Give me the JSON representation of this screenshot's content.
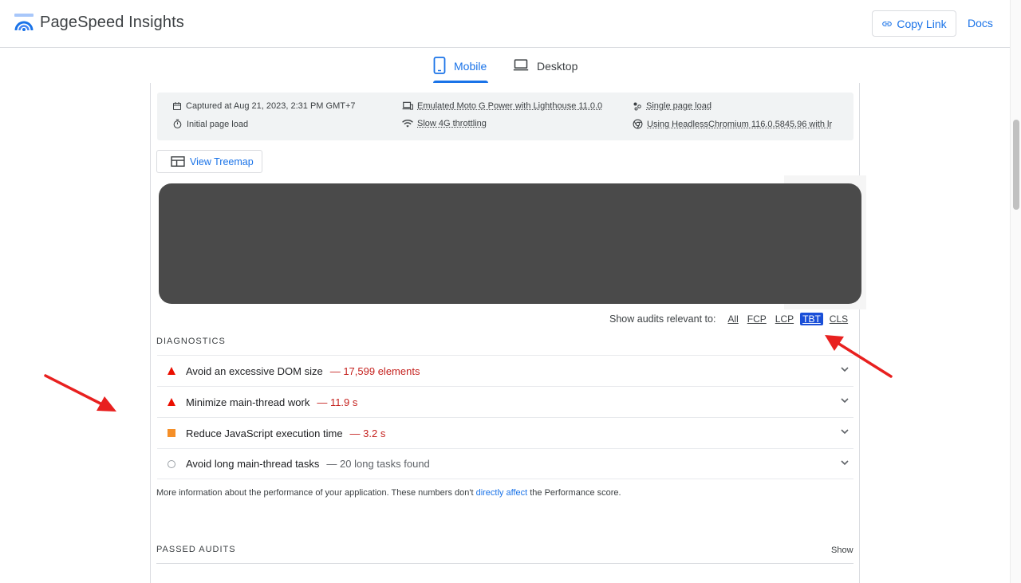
{
  "app": {
    "title": "PageSpeed Insights",
    "copy_link": "Copy Link",
    "docs": "Docs"
  },
  "tabs": [
    {
      "label": "Mobile",
      "active": true
    },
    {
      "label": "Desktop",
      "active": false
    }
  ],
  "runtime": {
    "captured": "Captured at Aug 21, 2023, 2:31 PM GMT+7",
    "page_load": "Initial page load",
    "device": "Emulated Moto G Power with Lighthouse 11.0.0",
    "throttling": "Slow 4G throttling",
    "session": "Single page load",
    "browser": "Using HeadlessChromium 116.0.5845.96 with lr"
  },
  "treemap": {
    "label": "View Treemap"
  },
  "filter": {
    "label": "Show audits relevant to:",
    "options": [
      "All",
      "FCP",
      "LCP",
      "TBT",
      "CLS"
    ],
    "selected": "TBT"
  },
  "diagnostics": {
    "title": "DIAGNOSTICS",
    "audits": [
      {
        "title": "Avoid an excessive DOM size",
        "value": "— 17,599 elements",
        "severity": "fail"
      },
      {
        "title": "Minimize main-thread work",
        "value": "— 11.9 s",
        "severity": "fail"
      },
      {
        "title": "Reduce JavaScript execution time",
        "value": "— 3.2 s",
        "severity": "average"
      },
      {
        "title": "Avoid long main-thread tasks",
        "value": "— 20 long tasks found",
        "severity": "info"
      }
    ],
    "description_pre": "More information about the performance of your application. These numbers don't ",
    "description_link": "directly affect",
    "description_post": " the Performance score."
  },
  "passed": {
    "title": "PASSED AUDITS",
    "show": "Show"
  },
  "colors": {
    "accent": "#1a73e8",
    "fail": "#eb0f00",
    "average": "#f58f28",
    "annotation": "#e8201f"
  }
}
